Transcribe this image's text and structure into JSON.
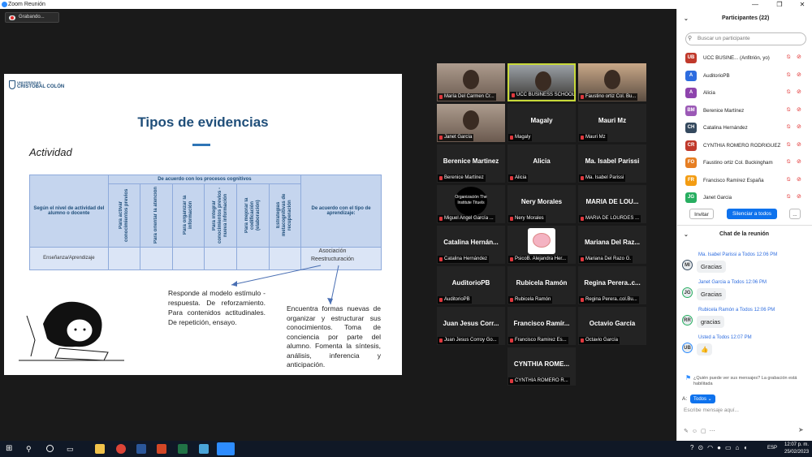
{
  "window": {
    "title": "Zoom Reunión",
    "minimize": "—",
    "maximize": "❐",
    "close": "✕"
  },
  "recording": {
    "label": "Grabando..."
  },
  "slide": {
    "brand_small": "UNIVERSIDAD",
    "brand_name": "CRISTÓBAL COLÓN",
    "title": "Tipos de evidencias",
    "activity": "Actividad",
    "table": {
      "row_header": "Según el nivel de actividad del alumno o docente",
      "group_header": "De acuerdo con los procesos cognitivos",
      "learning_header": "De acuerdo con el tipo de aprendizaje:",
      "columns": [
        "Para activar conocimientos previos",
        "Para orientar la atención",
        "Para organizar la información",
        "Para integrar conocimientos previos - nueva información",
        "Para mejorar la codificación (elaboración)",
        "Estrategias metacognitivas de recuperación"
      ],
      "row_label": "Enseñanza/Aprendizaje",
      "annotation": "Asociación\nReestructuración"
    },
    "text_left": "Responde al modelo estímulo - respuesta. De reforzamiento. Para contenidos actitudinales. De repetición, ensayo.",
    "text_right": "Encuentra formas nuevas de organizar y estructurar sus conocimientos. Toma de conciencia por parte del alumno. Fomenta la síntesis, análisis, inferencia y anticipación."
  },
  "tiles": [
    {
      "name": "",
      "label": "María Del Carmen Cr...",
      "video": true
    },
    {
      "name": "",
      "label": "UCC BUSINESS SCHOOL",
      "video": true,
      "active": true
    },
    {
      "name": "",
      "label": "Faustino ortiz Col. Bu...",
      "video": true
    },
    {
      "name": "",
      "label": "Janet García",
      "video": true
    },
    {
      "name": "Magaly",
      "label": "Magaly"
    },
    {
      "name": "Mauri Mz",
      "label": "Mauri Mz"
    },
    {
      "name": "Berenice Martinez",
      "label": "Berenice Martínez"
    },
    {
      "name": "Alicia",
      "label": "Alicia"
    },
    {
      "name": "Ma. Isabel Parissi",
      "label": "Ma. Isabel Parissi"
    },
    {
      "name": "",
      "label": "Miguel Angel García ...",
      "logo": "Organización The Institute Tituels"
    },
    {
      "name": "Nery Morales",
      "label": "Nery Morales"
    },
    {
      "name": "MARIA DE LOU...",
      "label": "MARIA DE LOURDES ..."
    },
    {
      "name": "Catalina  Hernán...",
      "label": "Catalina Hernández"
    },
    {
      "name": "",
      "label": "PsicoB. Alejandra Her...",
      "brain": true
    },
    {
      "name": "Mariana  Del  Raz...",
      "label": "Mariana Del Razo G."
    },
    {
      "name": "AuditorioPB",
      "label": "AuditorioPB"
    },
    {
      "name": "Rubicela Ramón",
      "label": "Rubicela Ramón"
    },
    {
      "name": "Regina  Perera..c...",
      "label": "Regina Perera..col.Bu..."
    },
    {
      "name": "Juan Jesus Corr...",
      "label": "Juan Jesus Corroy Go..."
    },
    {
      "name": "Francisco  Ramír...",
      "label": "Francisco Ramirez Es..."
    },
    {
      "name": "Octavio García",
      "label": "Octavio García"
    },
    {
      "name": "CYNTHIA  ROME...",
      "label": "CYNTHIA ROMERO R..."
    }
  ],
  "participants": {
    "title": "Participantes (22)",
    "search_placeholder": "Buscar un participante",
    "list": [
      {
        "initials": "UB",
        "name": "UCC BUSINE... (Anfitrión, yo)",
        "color": "#c0392b"
      },
      {
        "initials": "A",
        "name": "AuditorioPB",
        "color": "#2d6cdf"
      },
      {
        "initials": "A",
        "name": "Alicia",
        "color": "#8e44ad"
      },
      {
        "initials": "BM",
        "name": "Berenice Martínez",
        "color": "#9b59b6"
      },
      {
        "initials": "CH",
        "name": "Catalina Hernández",
        "color": "#34495e"
      },
      {
        "initials": "CR",
        "name": "CYNTHIA ROMERO RODRIGUEZ",
        "color": "#c0392b"
      },
      {
        "initials": "FO",
        "name": "Faustino ortiz Col. Buckingham",
        "color": "#e67e22"
      },
      {
        "initials": "FR",
        "name": "Francisco Ramírez España",
        "color": "#f39c12"
      },
      {
        "initials": "JG",
        "name": "Janet Garcia",
        "color": "#27ae60"
      }
    ],
    "invite": "Invitar",
    "mute_all": "Silenciar a todos",
    "more": "..."
  },
  "chat": {
    "title": "Chat de la reunión",
    "messages": [
      {
        "initials": "MI",
        "meta": "Ma. Isabel Parissi a Todos  12:06 PM",
        "text": "Gracias",
        "color": "#34495e"
      },
      {
        "initials": "JG",
        "meta": "Janet Garcia a Todos  12:06 PM",
        "text": "Gracias",
        "color": "#27ae60"
      },
      {
        "initials": "RR",
        "meta": "Rubicela Ramón a Todos  12:06 PM",
        "text": "gracias",
        "color": "#27ae60"
      },
      {
        "initials": "UB",
        "meta": "Usted a Todos  12:07 PM",
        "text": "👍",
        "color": "#2d8cff"
      }
    ],
    "notice": "¿Quién puede ver sus mensajes? La grabación está habilitada",
    "to_label": "A:",
    "to_value": "Todos",
    "input_placeholder": "Escribe mensaje aquí..."
  },
  "taskbar": {
    "lang": "ESP",
    "time": "12:07 p. m.",
    "date": "25/02/2023"
  }
}
